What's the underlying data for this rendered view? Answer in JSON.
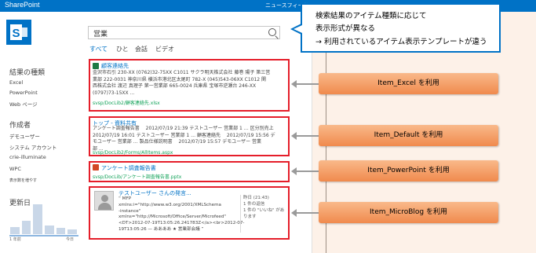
{
  "topbar": {
    "brand": "SharePoint",
    "newsfeed": "ニュースフィード"
  },
  "search": {
    "value": "営業"
  },
  "tabs": [
    "すべて",
    "ひと",
    "会話",
    "ビデオ"
  ],
  "sidebar": {
    "result_type": {
      "title": "結果の種類",
      "items": [
        "Excel",
        "PowerPoint",
        "Web ページ"
      ]
    },
    "author": {
      "title": "作成者",
      "items": [
        "デモユーザー",
        "システム アカウント",
        "crie-illuminate",
        "WPC"
      ],
      "more": "表示数を増やす"
    },
    "modified": {
      "title": "更新日",
      "bars": [
        0.25,
        0.45,
        1.0,
        0.3,
        0.2,
        0.15
      ],
      "from": "1 年前",
      "to": "今日"
    }
  },
  "results": [
    {
      "title": "顧客連絡先",
      "lines": [
        "金沢市石引 230-XX (0762)32-75XX C1011 サクラ明天株式会社 藤巻 陽子 第三営",
        "業部 222-0031 神奈川県 横浜市港北区太尾町 782-X (045)543-06XX C1012 関",
        "西株式会社 渡辺 真理子 第一営業部 665-0024 兵庫県 宝塚市逆瀬台 246-XX",
        "(0797)73-15XX ..."
      ],
      "path": "svsp/DocLib2/顧客連絡先.xlsx"
    },
    {
      "title": "トップ - 資料共有",
      "lines": [
        "アンケート調査報告書　 2012/07/19 21:39 テストユーザー 営業部 1 … 区分別売上",
        "2012/07/19 16:01 テストユーザー 営業部 1 … 顧客連絡先　 2012/07/19 15:56 デ",
        "モユーザー 営業部 … 製品仕様説明書　 2012/07/19 15:57 デモユーザー 営業",
        "部 ..."
      ],
      "path": "svsp/DocLib2/Forms/AllItems.aspx"
    },
    {
      "title": "アンケート調査報告書",
      "lines": [],
      "path": "svsp/DocLib/アンケート調査報告書.pptx"
    },
    {
      "title": "テストユーザー さんの発言...",
      "lines": [
        "“ MFP",
        "xmlns:i=\"http://www.w3.org/2001/XMLSchema",
        "-instance\"",
        "xmlns=\"http://Microsoft/Office/Server/Microfeed\"",
        "<DT>2012-07-19T13:05:26.241783Z</a><br>2012-07-",
        "19T13:05:26 — ああああ ★ 営業部会議 ”"
      ],
      "meta": [
        "昨日 (21:43)",
        "1 件の返信",
        "1 件の \"いいね\" があ",
        "ります"
      ]
    }
  ],
  "callouts": [
    "Item_Excel を利用",
    "Item_Default を利用",
    "Item_PowerPoint を利用",
    "Item_MicroBlog を利用"
  ],
  "note": [
    "検索結果のアイテム種類に応じて",
    "表示形式が異なる",
    "→ 利用されているアイテム表示テンプレートが違う"
  ]
}
